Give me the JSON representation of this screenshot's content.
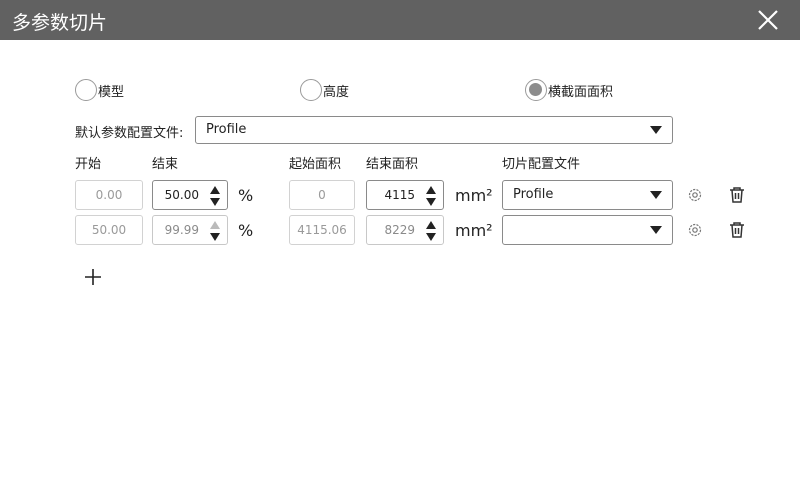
{
  "window": {
    "title": "多参数切片",
    "close_icon": "close-icon"
  },
  "modes": [
    {
      "label": "模型",
      "selected": false
    },
    {
      "label": "高度",
      "selected": false
    },
    {
      "label": "横截面面积",
      "selected": true
    }
  ],
  "default_profile": {
    "label": "默认参数配置文件:",
    "value": "Profile"
  },
  "columns": {
    "start": "开始",
    "end": "结束",
    "start_area": "起始面积",
    "end_area": "结束面积",
    "slice_profile": "切片配置文件"
  },
  "rows": [
    {
      "start": "0.00",
      "end": "50.00",
      "percent": "%",
      "start_area": "0",
      "end_area": "4115",
      "area_unit": "mm²",
      "profile": "Profile"
    },
    {
      "start": "50.00",
      "end": "99.99",
      "percent": "%",
      "start_area": "4115.06",
      "end_area": "8229",
      "area_unit": "mm²",
      "profile": ""
    }
  ],
  "icons": {
    "settings": "gear-icon",
    "delete": "trash-icon",
    "add": "plus-icon"
  }
}
